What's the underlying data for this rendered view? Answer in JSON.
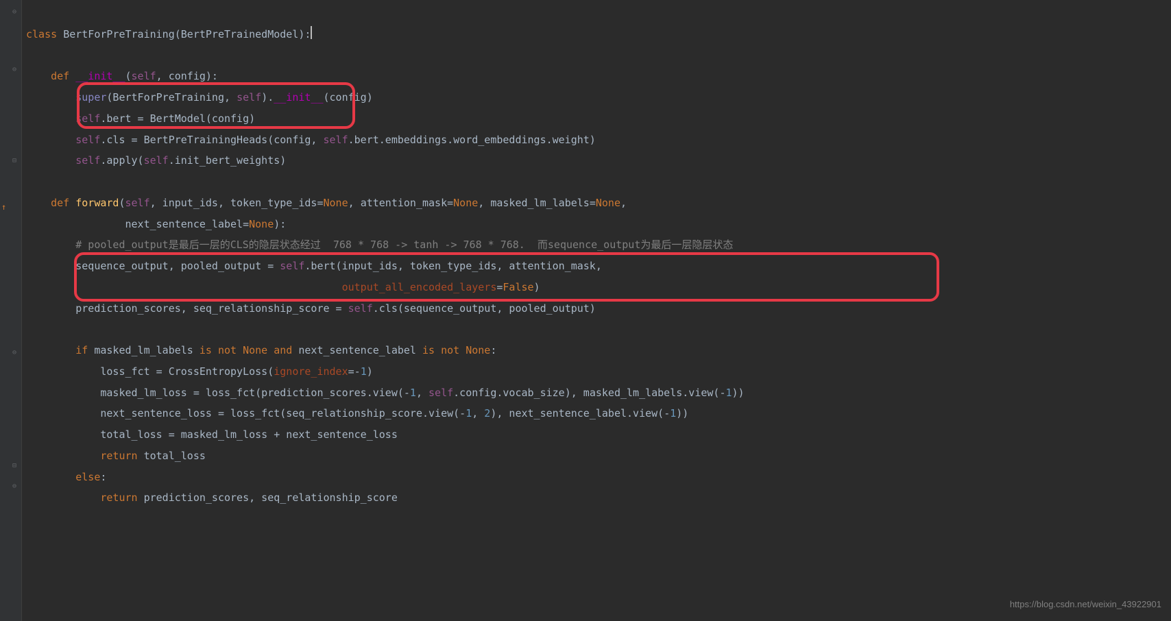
{
  "code": {
    "line1": {
      "class_kw": "class ",
      "class_name": "BertForPreTraining",
      "paren_open": "(",
      "parent": "BertPreTrainedModel",
      "paren_close": ")",
      "colon": ":"
    },
    "line3": {
      "indent": "    ",
      "def_kw": "def ",
      "fn_name": "__init__",
      "paren_open": "(",
      "self": "self",
      "comma": ", config):"
    },
    "line4": {
      "indent": "        ",
      "super": "super",
      "args_open": "(BertForPreTraining, ",
      "self": "self",
      "close": ").",
      "magic": "__init__",
      "rest": "(config)"
    },
    "line5": {
      "indent": "        ",
      "self": "self",
      "rest": ".bert = BertModel(config)"
    },
    "line6": {
      "indent": "        ",
      "self": "self",
      "mid1": ".cls = BertPreTrainingHeads(config, ",
      "self2": "self",
      "rest": ".bert.embeddings.word_embeddings.weight)"
    },
    "line7": {
      "indent": "        ",
      "self": "self",
      "mid": ".apply(",
      "self2": "self",
      "rest": ".init_bert_weights)"
    },
    "line9": {
      "indent": "    ",
      "def_kw": "def ",
      "fn_name": "forward",
      "paren_open": "(",
      "self": "self",
      "p1": ", input_ids, ",
      "p2k": "token_type_ids",
      "p2v": "=",
      "none1": "None",
      "p3": ", ",
      "p3k": "attention_mask",
      "p3v": "=",
      "none2": "None",
      "p4": ", ",
      "p4k": "masked_lm_labels",
      "p4v": "=",
      "none3": "None",
      "p5": ","
    },
    "line10": {
      "indent": "                ",
      "p1k": "next_sentence_label",
      "p1v": "=",
      "none1": "None",
      "close": "):"
    },
    "line11": {
      "indent": "        ",
      "comment": "# pooled_output是最后一层的CLS的隐层状态经过  768 * 768 -> tanh -> 768 * 768.  而sequence_output为最后一层隐层状态"
    },
    "line12": {
      "indent": "        ",
      "t1": "sequence_output, pooled_output = ",
      "self": "self",
      "rest": ".bert(input_ids, token_type_ids, attention_mask,"
    },
    "line13": {
      "indent": "                                                   ",
      "pk": "output_all_encoded_layers",
      "eq": "=",
      "false": "False",
      "close": ")"
    },
    "line14": {
      "indent": "        ",
      "t1": "prediction_scores, seq_relationship_score = ",
      "self": "self",
      "rest": ".cls(sequence_output, pooled_output)"
    },
    "line16": {
      "indent": "        ",
      "if": "if ",
      "t1": "masked_lm_labels ",
      "isnot1": "is not ",
      "none1": "None",
      "and": " and ",
      "t2": "next_sentence_label ",
      "isnot2": "is not ",
      "none2": "None",
      "colon": ":"
    },
    "line17": {
      "indent": "            ",
      "t1": "loss_fct = CrossEntropyLoss(",
      "pk": "ignore_index",
      "eq": "=-",
      "num": "1",
      "close": ")"
    },
    "line18": {
      "indent": "            ",
      "t1": "masked_lm_loss = loss_fct(prediction_scores.view(-",
      "n1": "1",
      "t2": ", ",
      "self": "self",
      "t3": ".config.vocab_size), masked_lm_labels.view(-",
      "n2": "1",
      "close": "))"
    },
    "line19": {
      "indent": "            ",
      "t1": "next_sentence_loss = loss_fct(seq_relationship_score.view(-",
      "n1": "1",
      "t2": ", ",
      "n2": "2",
      "t3": "), next_sentence_label.view(-",
      "n3": "1",
      "close": "))"
    },
    "line20": {
      "indent": "            ",
      "t1": "total_loss = masked_lm_loss + next_sentence_loss"
    },
    "line21": {
      "indent": "            ",
      "ret": "return ",
      "t1": "total_loss"
    },
    "line22": {
      "indent": "        ",
      "else": "else",
      "colon": ":"
    },
    "line23": {
      "indent": "            ",
      "ret": "return ",
      "t1": "prediction_scores, seq_relationship_score"
    }
  },
  "watermark": "https://blog.csdn.net/weixin_43922901",
  "gutter": {
    "change_marker": "↑",
    "fold_expand": "⊖"
  }
}
